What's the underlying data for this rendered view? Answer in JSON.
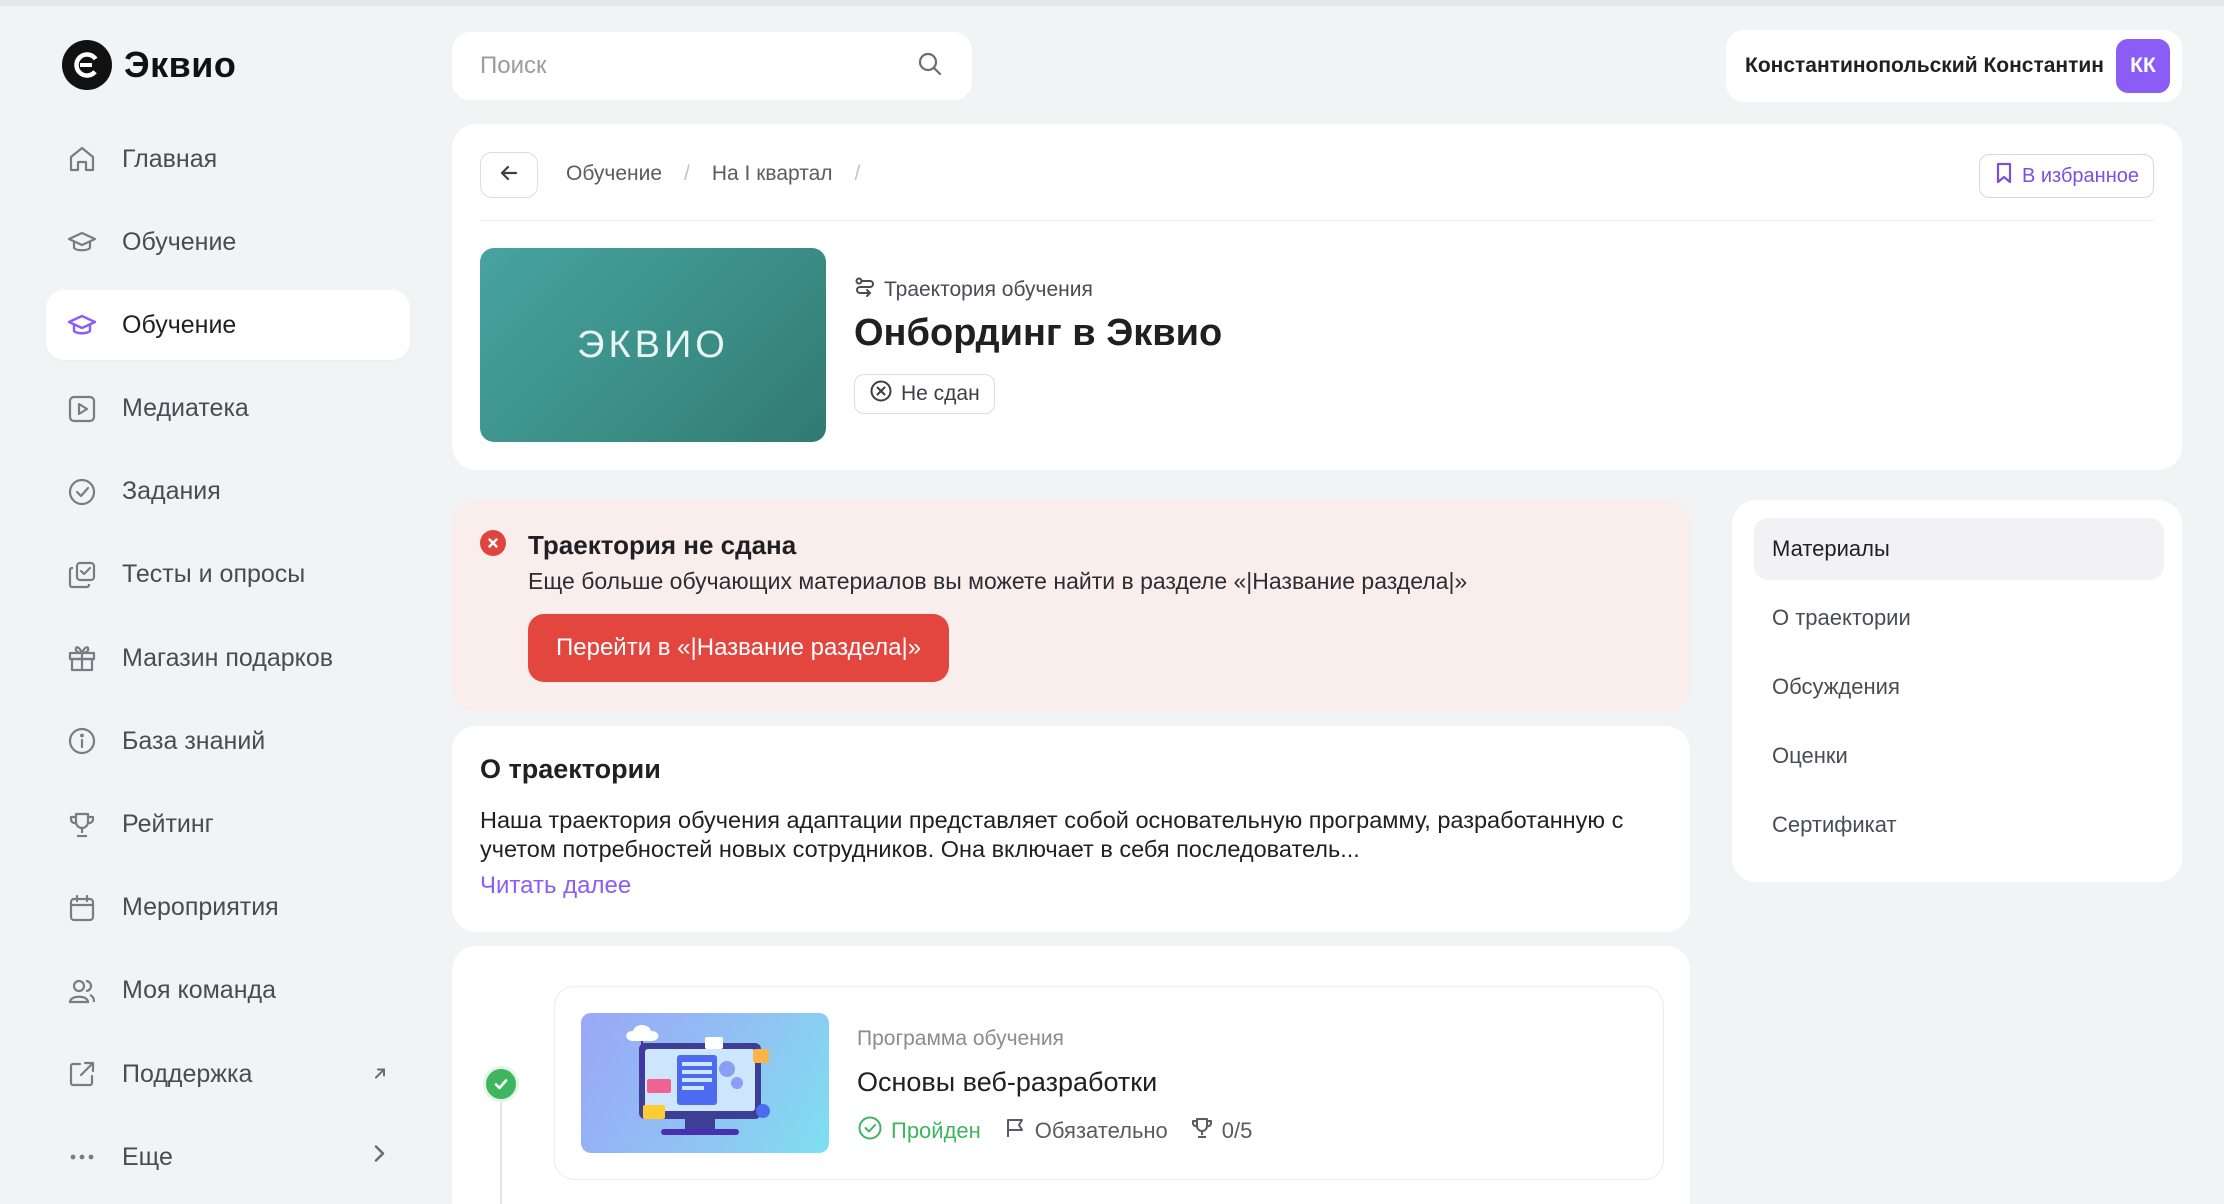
{
  "app": {
    "logo_text": "Эквио"
  },
  "sidebar": {
    "items": [
      {
        "label": "Главная",
        "icon": "home-icon"
      },
      {
        "label": "Обучение",
        "icon": "graduation-cap-icon"
      },
      {
        "label": "Обучение",
        "icon": "graduation-cap-icon",
        "active": true
      },
      {
        "label": "Медиатека",
        "icon": "play-icon"
      },
      {
        "label": "Задания",
        "icon": "check-circle-icon"
      },
      {
        "label": "Тесты и опросы",
        "icon": "tests-icon"
      },
      {
        "label": "Магазин подарков",
        "icon": "gift-icon"
      },
      {
        "label": "База знаний",
        "icon": "info-icon"
      },
      {
        "label": "Рейтинг",
        "icon": "trophy-icon"
      },
      {
        "label": "Мероприятия",
        "icon": "calendar-icon"
      },
      {
        "label": "Моя команда",
        "icon": "team-icon"
      },
      {
        "label": "Поддержка",
        "icon": "external-link-icon"
      },
      {
        "label": "Еще",
        "icon": "more-icon"
      }
    ]
  },
  "search": {
    "placeholder": "Поиск"
  },
  "user": {
    "name": "Константинопольский Константин",
    "initials": "КК",
    "avatar_color": "#8b5cf6"
  },
  "breadcrumbs": [
    "Обучение",
    "На I квартал"
  ],
  "favorite_label": "В избранное",
  "course": {
    "cover_text": "ЭКВИО",
    "type_label": "Траектория обучения",
    "title": "Онбординг в Эквио",
    "status": "Не сдан"
  },
  "alert": {
    "title": "Траектория не сдана",
    "text": "Еще больше обучающих материалов вы можете найти в разделе «|Название раздела|»",
    "button": "Перейти в  «|Название раздела|»",
    "color": "#e2463f"
  },
  "about": {
    "title": "О траектории",
    "text": "Наша траектория обучения адаптации представляет собой основательную программу, разработанную с учетом потребностей новых сотрудников. Она включает в себя последователь...",
    "more": "Читать далее"
  },
  "sections": {
    "items": [
      "Материалы",
      "О траектории",
      "Обсуждения",
      "Оценки",
      "Сертификат"
    ]
  },
  "program": {
    "type": "Программа обучения",
    "title": "Основы веб-разработки",
    "status": "Пройден",
    "required": "Обязательно",
    "score": "0/5"
  },
  "colors": {
    "accent": "#8b5cf6",
    "success": "#3fb55f",
    "danger": "#e2463f"
  }
}
